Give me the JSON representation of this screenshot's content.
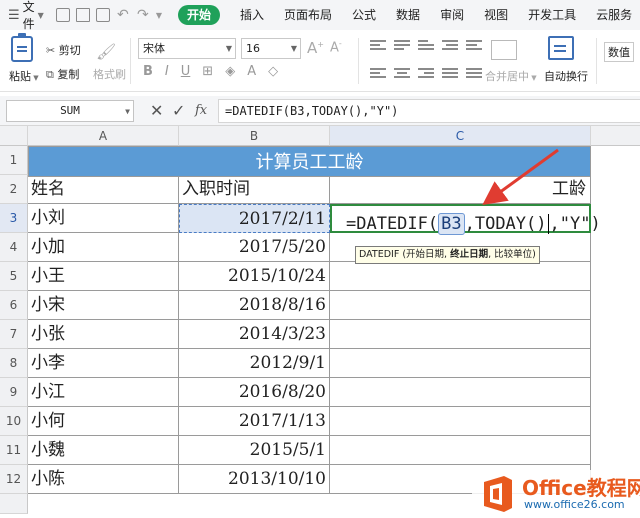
{
  "menubar": {
    "file_label": "文件",
    "tabs": [
      "开始",
      "插入",
      "页面布局",
      "公式",
      "数据",
      "审阅",
      "视图",
      "开发工具",
      "云服务"
    ],
    "active_tab": "开始"
  },
  "ribbon": {
    "paste": "粘贴",
    "cut": "剪切",
    "copy": "复制",
    "format_painter": "格式刷",
    "font_name": "宋体",
    "font_size": "16",
    "merge_center": "合并居中",
    "wrap_text": "自动换行",
    "number_format": "数值"
  },
  "formula_bar": {
    "name_box": "SUM",
    "fx": "fx",
    "formula": "=DATEDIF(B3,TODAY(),\"Y\")"
  },
  "columns": [
    "A",
    "B",
    "C"
  ],
  "rows": [
    "1",
    "2",
    "3",
    "4",
    "5",
    "6",
    "7",
    "8",
    "9",
    "10",
    "11",
    "12"
  ],
  "sheet": {
    "title": "计算员工工龄",
    "header_name": "姓名",
    "header_date": "入职时间",
    "header_age": "工龄",
    "employees": [
      {
        "name": "小刘",
        "date": "2017/2/11"
      },
      {
        "name": "小加",
        "date": "2017/5/20"
      },
      {
        "name": "小王",
        "date": "2015/10/24"
      },
      {
        "name": "小宋",
        "date": "2018/8/16"
      },
      {
        "name": "小张",
        "date": "2014/3/23"
      },
      {
        "name": "小李",
        "date": "2012/9/1"
      },
      {
        "name": "小江",
        "date": "2016/8/20"
      },
      {
        "name": "小何",
        "date": "2017/1/13"
      },
      {
        "name": "小魏",
        "date": "2015/5/1"
      },
      {
        "name": "小陈",
        "date": "2013/10/10"
      }
    ],
    "formula_parts": {
      "prefix": "=DATEDIF(",
      "ref": "B3",
      "middle": ",TODAY()",
      "suffix": ",\"Y\")"
    },
    "tooltip": {
      "fn": "DATEDIF",
      "open": " (开始日期, ",
      "bold": "终止日期",
      "close": ", 比较单位)"
    }
  },
  "watermark": {
    "title": "Office教程网",
    "url": "www.office26.com"
  },
  "colors": {
    "accent_green": "#1fa15a",
    "title_fill": "#5b9bd5",
    "arrow_red": "#e03c31",
    "selection_blue": "#dbe5f4"
  }
}
